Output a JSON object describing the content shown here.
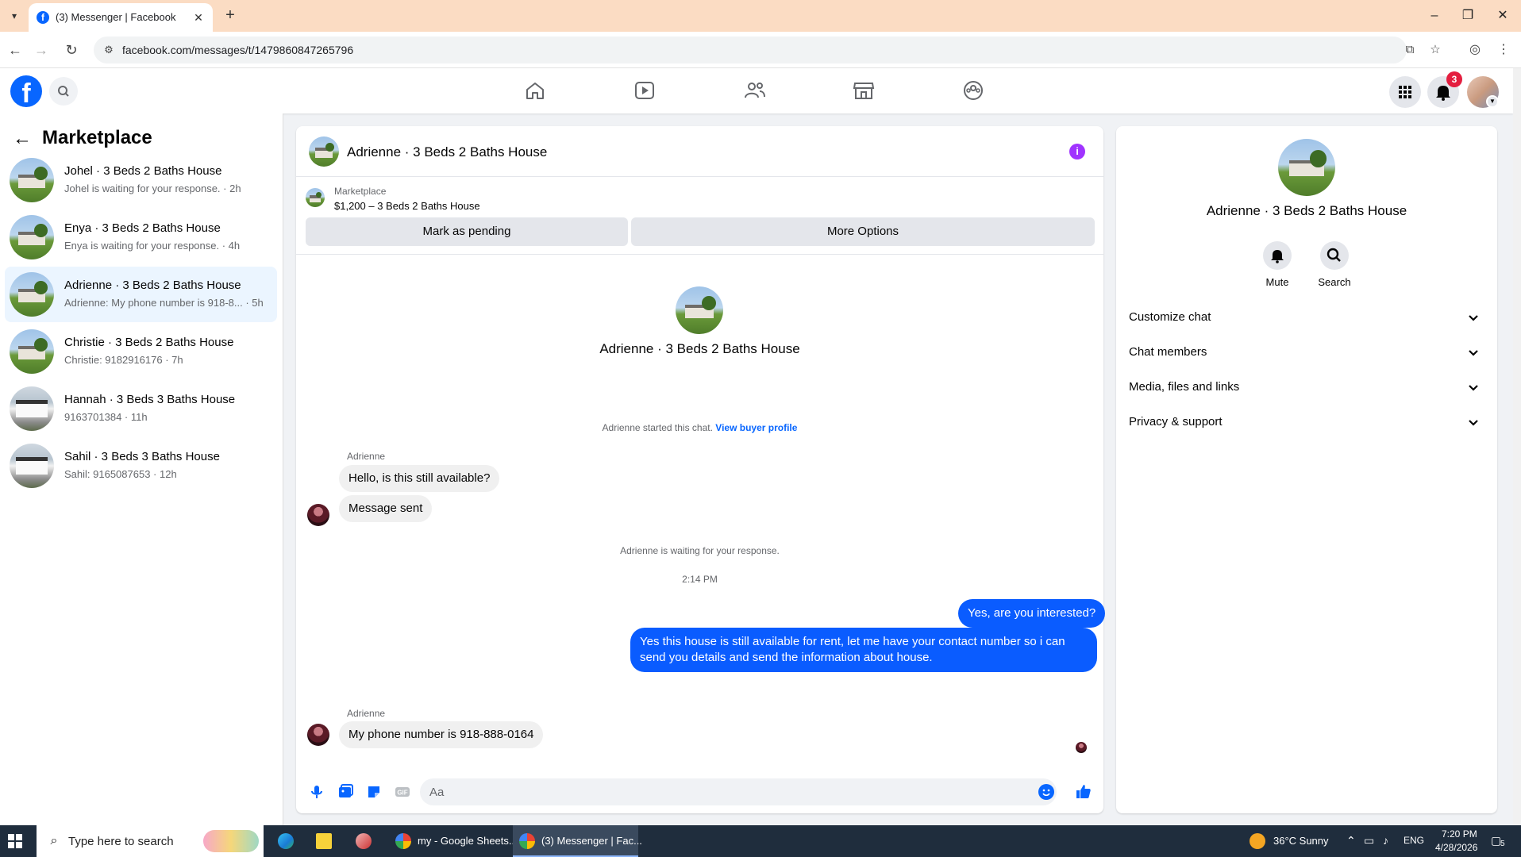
{
  "browser": {
    "tab_title": "(3) Messenger | Facebook",
    "url": "facebook.com/messages/t/1479860847265796"
  },
  "header": {
    "notification_count": "3"
  },
  "sidebar": {
    "title": "Marketplace",
    "conversations": [
      {
        "name": "Johel · 3 Beds 2 Baths House",
        "preview": "Johel is waiting for your response. · 2h"
      },
      {
        "name": "Enya · 3 Beds 2 Baths House",
        "preview": "Enya is waiting for your response. · 4h"
      },
      {
        "name": "Adrienne · 3 Beds 2 Baths House",
        "preview": "Adrienne: My phone number is 918-8... · 5h"
      },
      {
        "name": "Christie · 3 Beds 2 Baths House",
        "preview": "Christie: 9182916176 · 7h"
      },
      {
        "name": "Hannah · 3 Beds 3 Baths House",
        "preview": "9163701384 · 11h"
      },
      {
        "name": "Sahil · 3 Beds 3 Baths House",
        "preview": "Sahil: 9165087653 · 12h"
      }
    ]
  },
  "chat": {
    "title": "Adrienne · 3 Beds 2 Baths House",
    "marketplace_label": "Marketplace",
    "listing": "$1,200 – 3 Beds 2 Baths House",
    "mark_pending": "Mark as pending",
    "more_options": "More Options",
    "intro_name": "Adrienne · 3 Beds 2 Baths House",
    "started_text": "Adrienne started this chat.",
    "view_profile": "View buyer profile",
    "sender": "Adrienne",
    "msg1": "Hello, is this still available?",
    "msg2": "Message sent",
    "waiting": "Adrienne is waiting for your response.",
    "time": "2:14 PM",
    "reply1": "Yes, are you interested?",
    "reply2": "Yes this house is still available for rent, let me have your contact number so i can send you details and send the information about house.",
    "msg3": "My phone number is 918-888-0164",
    "composer_placeholder": "Aa"
  },
  "details": {
    "name": "Adrienne · 3 Beds 2 Baths House",
    "mute": "Mute",
    "search": "Search",
    "sections": [
      "Customize chat",
      "Chat members",
      "Media, files and links",
      "Privacy & support"
    ]
  },
  "taskbar": {
    "search_placeholder": "Type here to search",
    "app1": "my - Google Sheets...",
    "app2": "(3) Messenger | Fac...",
    "weather": "36°C  Sunny",
    "lang": "ENG",
    "time": "7:20 PM",
    "date": "4/28/2026",
    "notif_count": "5"
  },
  "colors": {
    "fb_blue": "#0866ff",
    "outgoing_bubble": "#0a5cff",
    "tab_strip": "#fbdcc3"
  }
}
